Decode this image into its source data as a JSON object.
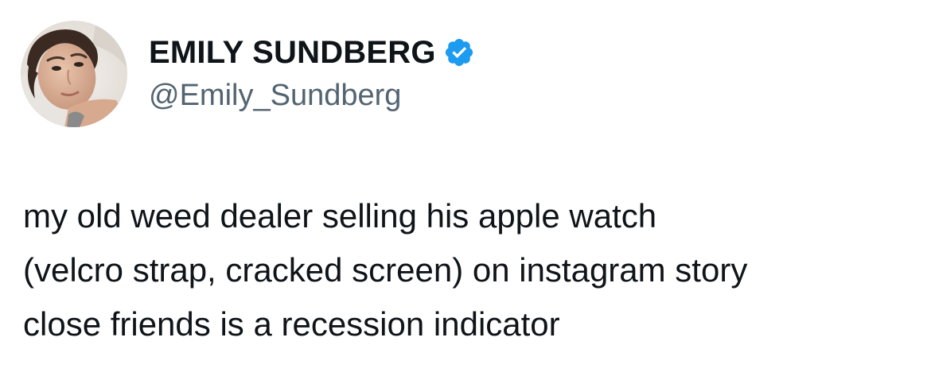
{
  "author": {
    "display_name": "EMILY SUNDBERG",
    "handle": "@Emily_Sundberg",
    "verified": true,
    "verified_icon": "verified-badge-icon",
    "verified_color": "#1d9bf0"
  },
  "tweet": {
    "text": "my old weed dealer selling his apple watch\n(velcro strap, cracked screen) on instagram story\nclose friends is a recession indicator"
  },
  "colors": {
    "text_primary": "#0f1419",
    "text_secondary": "#536471",
    "background": "#ffffff"
  }
}
